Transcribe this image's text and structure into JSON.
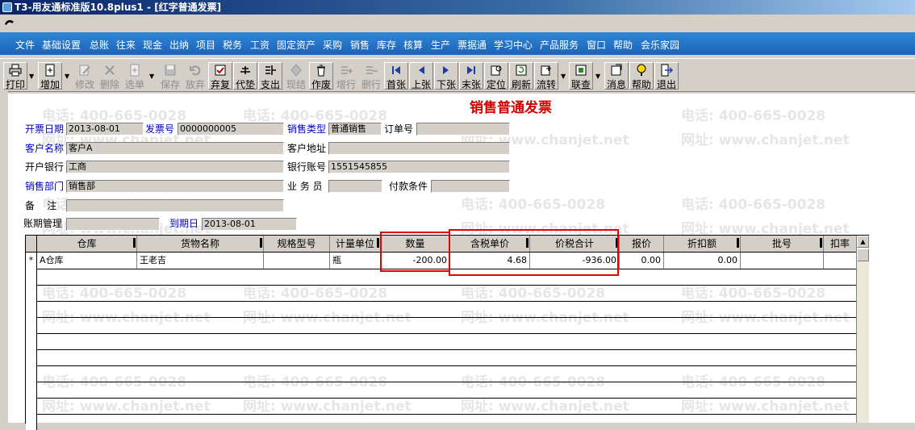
{
  "window": {
    "title": "T3-用友通标准版10.8plus1 - [红字普通发票]"
  },
  "menu": [
    "文件",
    "基础设置",
    "总账",
    "往来",
    "现金",
    "出纳",
    "项目",
    "税务",
    "工资",
    "固定资产",
    "采购",
    "销售",
    "库存",
    "核算",
    "生产",
    "票据通",
    "学习中心",
    "产品服务",
    "窗口",
    "帮助",
    "会乐家园"
  ],
  "toolbar": [
    {
      "label": "打印",
      "icon": "printer-icon",
      "enabled": true
    },
    {
      "label": "增加",
      "icon": "new-doc-icon",
      "enabled": true
    },
    {
      "label": "修改",
      "icon": "edit-icon",
      "enabled": false
    },
    {
      "label": "删除",
      "icon": "delete-icon",
      "enabled": false
    },
    {
      "label": "选单",
      "icon": "select-doc-icon",
      "enabled": false
    },
    {
      "label": "保存",
      "icon": "save-icon",
      "enabled": false
    },
    {
      "label": "放弃",
      "icon": "undo-icon",
      "enabled": false
    },
    {
      "label": "弃复",
      "icon": "restore-icon",
      "enabled": true
    },
    {
      "label": "代垫",
      "icon": "advance-icon",
      "enabled": true
    },
    {
      "label": "支出",
      "icon": "expense-icon",
      "enabled": true
    },
    {
      "label": "现结",
      "icon": "cash-settle-icon",
      "enabled": false
    },
    {
      "label": "作废",
      "icon": "void-icon",
      "enabled": true
    },
    {
      "label": "增行",
      "icon": "add-row-icon",
      "enabled": false
    },
    {
      "label": "删行",
      "icon": "delete-row-icon",
      "enabled": false
    },
    {
      "label": "首张",
      "icon": "first-icon",
      "enabled": true
    },
    {
      "label": "上张",
      "icon": "prev-icon",
      "enabled": true
    },
    {
      "label": "下张",
      "icon": "next-icon",
      "enabled": true
    },
    {
      "label": "末张",
      "icon": "last-icon",
      "enabled": true
    },
    {
      "label": "定位",
      "icon": "locate-icon",
      "enabled": true
    },
    {
      "label": "刷新",
      "icon": "refresh-icon",
      "enabled": true
    },
    {
      "label": "流转",
      "icon": "flow-icon",
      "enabled": true
    },
    {
      "label": "联查",
      "icon": "link-query-icon",
      "enabled": true
    },
    {
      "label": "消息",
      "icon": "message-icon",
      "enabled": true
    },
    {
      "label": "帮助",
      "icon": "help-icon",
      "enabled": true
    },
    {
      "label": "退出",
      "icon": "exit-icon",
      "enabled": true
    }
  ],
  "form": {
    "title": "销售普通发票",
    "invoice_date_label": "开票日期",
    "invoice_date": "2013-08-01",
    "invoice_no_label": "发票号",
    "invoice_no": "0000000005",
    "sale_type_label": "销售类型",
    "sale_type": "普通销售",
    "order_no_label": "订单号",
    "order_no": "",
    "customer_label": "客户名称",
    "customer": "客户A",
    "customer_addr_label": "客户地址",
    "customer_addr": "",
    "bank_label": "开户银行",
    "bank": "工商",
    "bank_account_label": "银行账号",
    "bank_account": "1551545855",
    "dept_label": "销售部门",
    "dept": "销售部",
    "salesman_label": "业 务 员",
    "salesman": "",
    "payment_terms_label": "付款条件",
    "payment_terms": "",
    "remark_label": "备    注",
    "remark": "",
    "term_mgmt_label": "账期管理",
    "term_mgmt": "",
    "due_date_label": "到期日",
    "due_date": "2013-08-01"
  },
  "grid": {
    "headers": [
      "仓库",
      "货物名称",
      "规格型号",
      "计量单位",
      "数量",
      "含税单价",
      "价税合计",
      "报价",
      "折扣额",
      "批号",
      "扣率"
    ],
    "rows": [
      {
        "marker": "*",
        "warehouse": "A仓库",
        "item": "王老吉",
        "spec": "",
        "unit": "瓶",
        "qty": "-200.00",
        "price": "4.68",
        "total": "-936.00",
        "quote": "0.00",
        "discount": "0.00",
        "batch": "",
        "rate": ""
      }
    ]
  },
  "watermark": {
    "phone": "电话: 400-665-0028",
    "site": "网址: www.chanjet.net"
  },
  "colors": {
    "menu_bg": "#1b63b8",
    "title_red": "#d40000",
    "label_blue": "#0000c0",
    "highlight": "#e60000"
  }
}
